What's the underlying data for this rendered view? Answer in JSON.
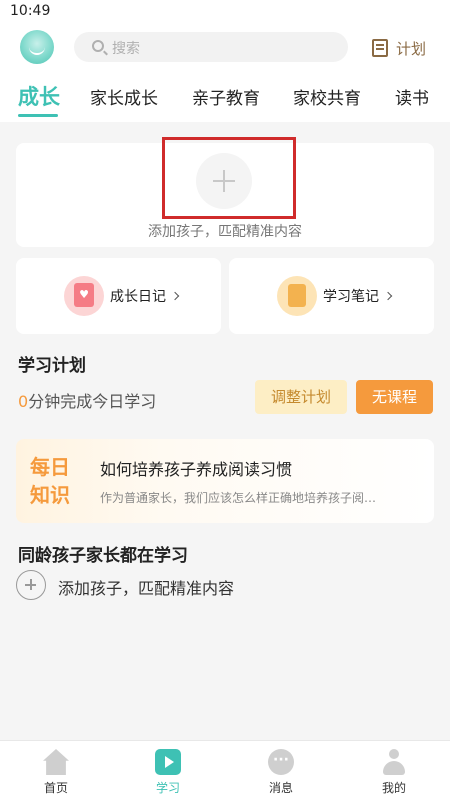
{
  "status_bar": {
    "time": "10:49"
  },
  "header": {
    "search_placeholder": "搜索",
    "plan_label": "计划"
  },
  "tabs": [
    {
      "label": "成长",
      "active": true
    },
    {
      "label": "家长成长"
    },
    {
      "label": "亲子教育"
    },
    {
      "label": "家校共育"
    },
    {
      "label": "读书"
    }
  ],
  "add_child_card": {
    "text": "添加孩子，匹配精准内容"
  },
  "features": {
    "diary": {
      "label": "成长日记"
    },
    "notes": {
      "label": "学习笔记"
    }
  },
  "study_plan": {
    "title": "学习计划",
    "minutes": "0",
    "subtitle": "分钟完成今日学习",
    "adjust_label": "调整计划",
    "no_course_label": "无课程"
  },
  "daily_knowledge": {
    "badge_line1": "每日",
    "badge_line2": "知识",
    "title": "如何培养孩子养成阅读习惯",
    "desc": "作为普通家长，我们应该怎么样正确地培养孩子阅…"
  },
  "peers": {
    "title": "同龄孩子家长都在学习",
    "add_text": "添加孩子，匹配精准内容"
  },
  "bottom_nav": [
    {
      "label": "首页"
    },
    {
      "label": "学习",
      "active": true
    },
    {
      "label": "消息"
    },
    {
      "label": "我的"
    }
  ],
  "colors": {
    "accent": "#3ec1b4",
    "orange": "#f59a3d",
    "highlight_box": "#d02b2b"
  }
}
